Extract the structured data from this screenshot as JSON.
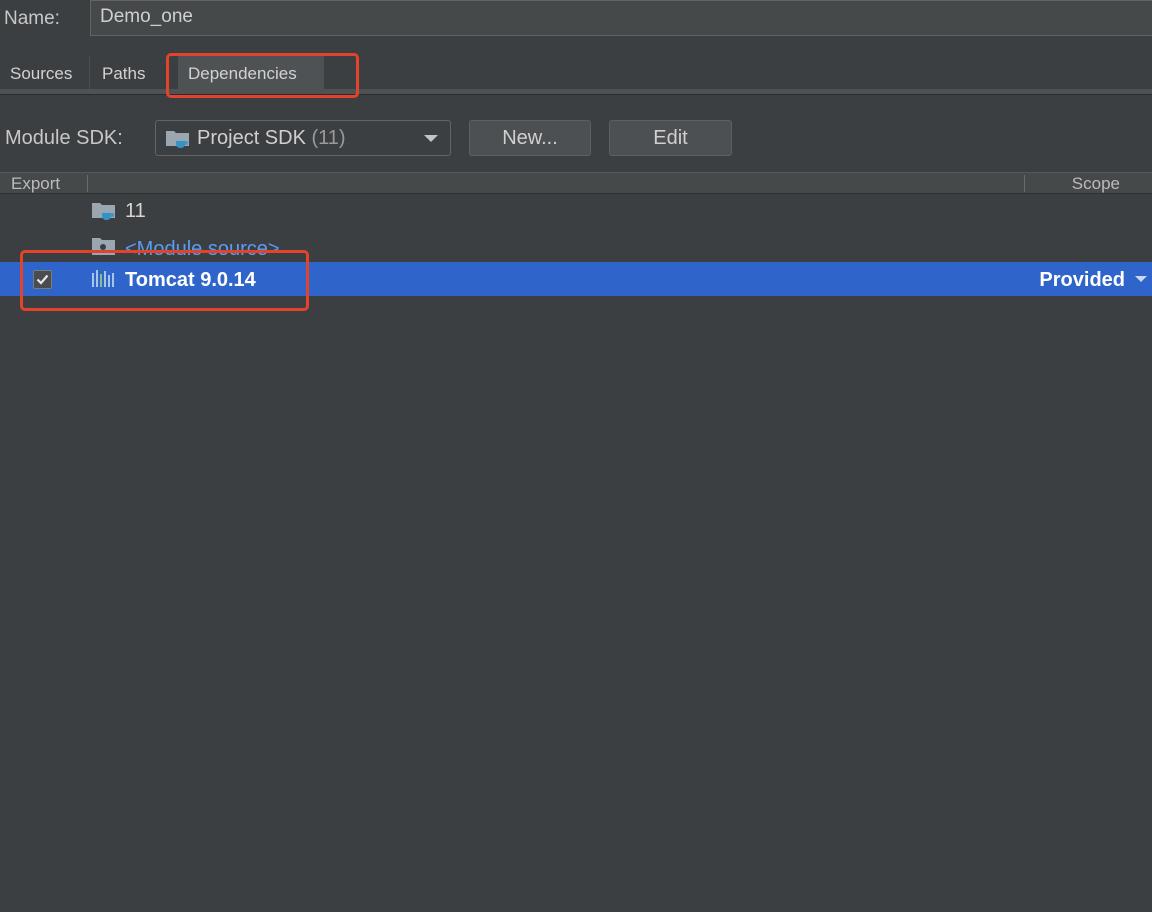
{
  "name_field": {
    "label": "Name:",
    "value": "Demo_one"
  },
  "tabs": [
    {
      "label": "Sources",
      "active": false
    },
    {
      "label": "Paths",
      "active": false
    },
    {
      "label": "Dependencies",
      "active": true
    }
  ],
  "sdk_row": {
    "label": "Module SDK:",
    "selected_value": "Project SDK",
    "selected_detail": "(11)",
    "icon": "folder-icon",
    "new_button": "New...",
    "edit_button": "Edit"
  },
  "table": {
    "columns": [
      "Export",
      "Scope"
    ],
    "rows": [
      {
        "icon": "sdk-folder-icon",
        "label": "11",
        "selected": false
      },
      {
        "icon": "module-source-folder-icon",
        "label": "<Module source>",
        "selected": false
      },
      {
        "icon": "library-icon",
        "label": "Tomcat 9.0.14",
        "selected": true,
        "exported": true,
        "scope": "Provided"
      }
    ]
  },
  "colors": {
    "background": "#3c3f41",
    "selection": "#2f65ca",
    "link": "#589df6",
    "annotation": "#e2432a"
  }
}
